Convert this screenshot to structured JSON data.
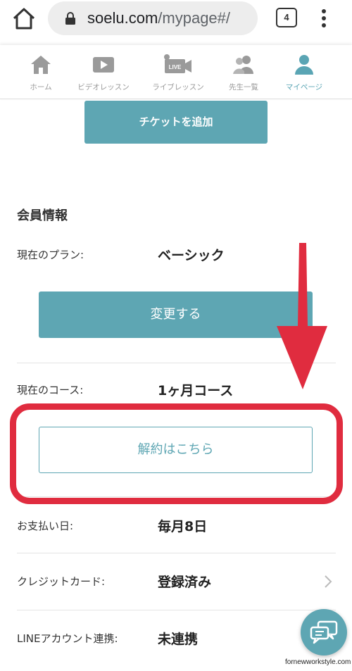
{
  "browser": {
    "url_domain": "soelu.com",
    "url_path": "/mypage#/",
    "tab_count": "4"
  },
  "nav": {
    "items": [
      {
        "label": "ホーム",
        "icon": "home-icon"
      },
      {
        "label": "ビデオレッスン",
        "icon": "play-video-icon"
      },
      {
        "label": "ライブレッスン",
        "icon": "live-camera-icon",
        "badge": "LIVE"
      },
      {
        "label": "先生一覧",
        "icon": "people-icon"
      },
      {
        "label": "マイページ",
        "icon": "user-icon",
        "active": true
      }
    ],
    "active_color": "#5aa5b4",
    "inactive_color": "#9a9a9a"
  },
  "ticket_button": "チケットを追加",
  "member_info": {
    "title": "会員情報",
    "plan_label": "現在のプラン:",
    "plan_value": "ベーシック",
    "change_button": "変更する",
    "course_label": "現在のコース:",
    "course_value": "1ヶ月コース",
    "cancel_button": "解約はこちら",
    "payment_label": "お支払い日:",
    "payment_value": "毎月8日",
    "card_label": "クレジットカード:",
    "card_value": "登録済み",
    "line_label": "LINEアカウント連携:",
    "line_value": "未連携"
  },
  "colors": {
    "accent": "#5ea6b3",
    "highlight": "#e02c3f"
  },
  "watermark": "fornewworkstyle.com"
}
